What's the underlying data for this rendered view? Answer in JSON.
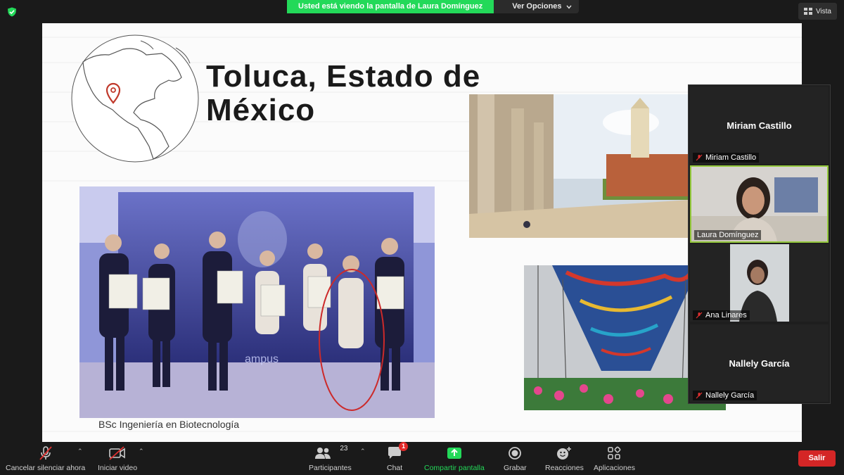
{
  "meeting": {
    "sharing_banner": "Usted está viendo la pantalla de Laura Domínguez",
    "view_options": "Ver Opciones",
    "view_label": "Vista"
  },
  "slide": {
    "title": "Toluca, Estado de México",
    "caption": "BSc Ingeniería en Biotecnología"
  },
  "participants": [
    {
      "name": "Miriam Castillo",
      "video": false,
      "muted": true
    },
    {
      "name": "Laura Domínguez",
      "video": true,
      "muted": false,
      "active": true
    },
    {
      "name": "Ana Linares",
      "video": true,
      "muted": true
    },
    {
      "name": "Nallely García",
      "video": false,
      "muted": true
    }
  ],
  "toolbar": {
    "unmute": "Cancelar silenciar ahora",
    "start_video": "Iniciar video",
    "participants": "Participantes",
    "participants_count": "23",
    "chat": "Chat",
    "chat_badge": "1",
    "share_screen": "Compartir pantalla",
    "record": "Grabar",
    "reactions": "Reacciones",
    "apps": "Aplicaciones",
    "leave": "Salir"
  },
  "colors": {
    "share_green": "#23d959",
    "leave_red": "#d42626",
    "active_speaker": "#93c83b"
  }
}
